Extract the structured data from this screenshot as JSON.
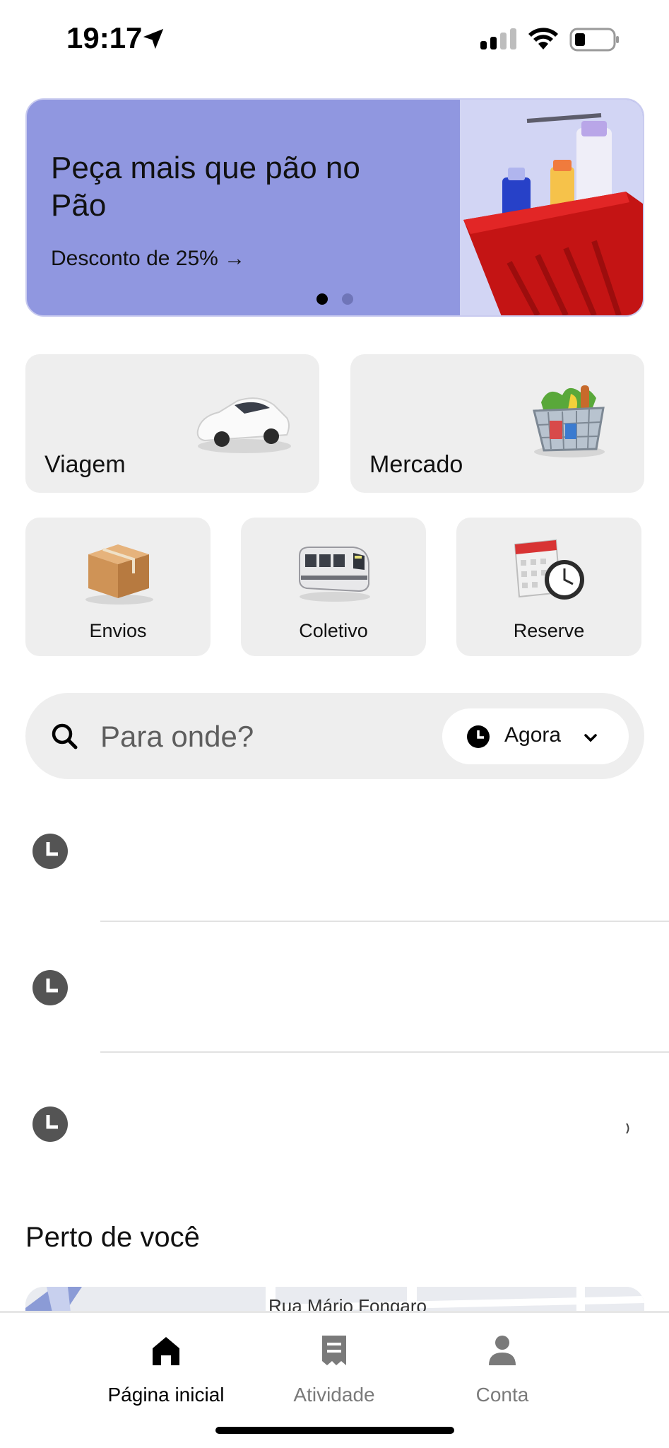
{
  "status_bar": {
    "time": "19:17",
    "icons": [
      "location-arrow-icon",
      "cellular-signal-icon",
      "wifi-icon",
      "battery-icon"
    ]
  },
  "promo": {
    "title": "Peça mais que pão no Pão",
    "link": "Desconto de 25% →",
    "page_count": 2,
    "active_page": 1,
    "colors": {
      "background": "#9097e0",
      "art_background": "#d2d5f4"
    }
  },
  "services": {
    "large": [
      {
        "label": "Viagem",
        "icon": "car-icon"
      },
      {
        "label": "Mercado",
        "icon": "grocery-basket-icon"
      }
    ],
    "small": [
      {
        "label": "Envios",
        "icon": "package-icon"
      },
      {
        "label": "Coletivo",
        "icon": "train-icon"
      },
      {
        "label": "Reserve",
        "icon": "calendar-clock-icon"
      }
    ]
  },
  "search": {
    "placeholder": "Para onde?",
    "time_selector": "Agora"
  },
  "recent_destinations": [
    {
      "icon": "history-clock-icon"
    },
    {
      "icon": "history-clock-icon"
    },
    {
      "icon": "history-clock-icon"
    }
  ],
  "nearby": {
    "title": "Perto de você",
    "street_label": "Rua Mário Fongaro"
  },
  "tab_bar": {
    "tabs": [
      {
        "label": "Página inicial",
        "icon": "home-icon",
        "active": true
      },
      {
        "label": "Atividade",
        "icon": "receipt-icon",
        "active": false
      },
      {
        "label": "Conta",
        "icon": "person-icon",
        "active": false
      }
    ]
  },
  "colors": {
    "accent": "#000000",
    "tile_background": "#eeeeee",
    "inactive_tab": "#7a7a7a"
  }
}
